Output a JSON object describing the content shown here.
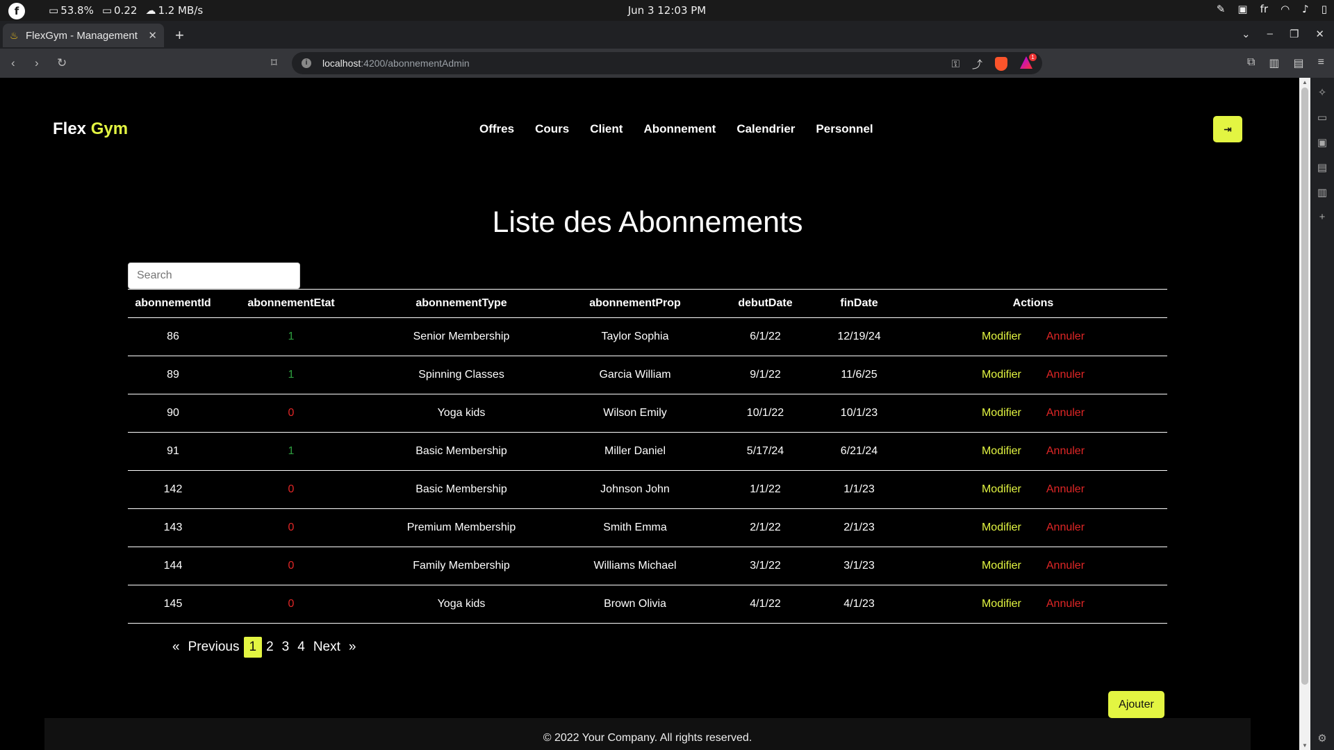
{
  "os": {
    "battery": "53.8%",
    "load": "0.22",
    "network": "1.2 MB/s",
    "datetime": "Jun 3  12:03 PM",
    "lang": "fr"
  },
  "browser": {
    "tab_title": "FlexGym - Management",
    "url_host": "localhost",
    "url_path": ":4200/abonnementAdmin",
    "rewards_badge": "1"
  },
  "brand": {
    "part1": "Flex",
    "part2": "Gym"
  },
  "nav": [
    {
      "label": "Offres"
    },
    {
      "label": "Cours"
    },
    {
      "label": "Client"
    },
    {
      "label": "Abonnement"
    },
    {
      "label": "Calendrier"
    },
    {
      "label": "Personnel"
    }
  ],
  "title": "Liste des Abonnements",
  "search": {
    "placeholder": "Search"
  },
  "table": {
    "headers": [
      "abonnementId",
      "abonnementEtat",
      "abonnementType",
      "abonnementProp",
      "debutDate",
      "finDate",
      "Actions"
    ],
    "rows": [
      {
        "id": "86",
        "etat": "1",
        "type": "Senior Membership",
        "prop": "Taylor Sophia",
        "debut": "6/1/22",
        "fin": "12/19/24"
      },
      {
        "id": "89",
        "etat": "1",
        "type": "Spinning Classes",
        "prop": "Garcia William",
        "debut": "9/1/22",
        "fin": "11/6/25"
      },
      {
        "id": "90",
        "etat": "0",
        "type": "Yoga kids",
        "prop": "Wilson Emily",
        "debut": "10/1/22",
        "fin": "10/1/23"
      },
      {
        "id": "91",
        "etat": "1",
        "type": "Basic Membership",
        "prop": "Miller Daniel",
        "debut": "5/17/24",
        "fin": "6/21/24"
      },
      {
        "id": "142",
        "etat": "0",
        "type": "Basic Membership",
        "prop": "Johnson John",
        "debut": "1/1/22",
        "fin": "1/1/23"
      },
      {
        "id": "143",
        "etat": "0",
        "type": "Premium Membership",
        "prop": "Smith Emma",
        "debut": "2/1/22",
        "fin": "2/1/23"
      },
      {
        "id": "144",
        "etat": "0",
        "type": "Family Membership",
        "prop": "Williams Michael",
        "debut": "3/1/22",
        "fin": "3/1/23"
      },
      {
        "id": "145",
        "etat": "0",
        "type": "Yoga kids",
        "prop": "Brown Olivia",
        "debut": "4/1/22",
        "fin": "4/1/23"
      }
    ],
    "action_modify": "Modifier",
    "action_cancel": "Annuler"
  },
  "pagination": {
    "first": "«",
    "previous": "Previous",
    "pages": [
      "1",
      "2",
      "3",
      "4"
    ],
    "current": "1",
    "next": "Next",
    "last": "»"
  },
  "add_button": "Ajouter",
  "footer": "© 2022 Your Company. All rights reserved.",
  "colors": {
    "accent": "#e3f542",
    "active": "#2e9e3f",
    "inactive": "#e02626"
  }
}
